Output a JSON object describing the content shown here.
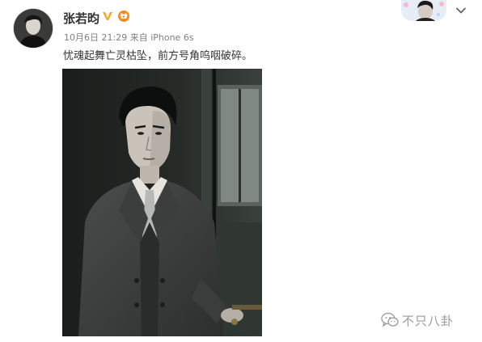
{
  "post": {
    "username": "张若昀",
    "date_time": "10月6日 21:29",
    "source": "来自 iPhone 6s",
    "text": "忧魂起舞亡灵枯坠，前方号角呜咽破碎。"
  },
  "icons": {
    "verified": "verified-v-badge-icon",
    "vip": "vip-member-icon",
    "more": "chevron-down-icon",
    "watermark": "wechat-icon"
  },
  "watermark": {
    "text": "不只八卦"
  },
  "colors": {
    "verified": "#f5a623",
    "meta": "#808080",
    "text": "#333333"
  }
}
